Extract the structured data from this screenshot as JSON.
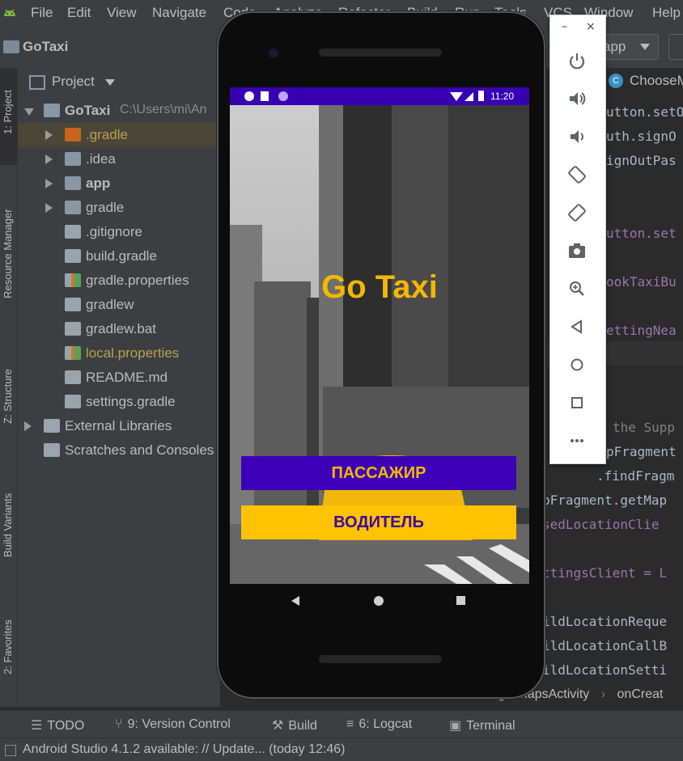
{
  "menubar": {
    "items": [
      "File",
      "Edit",
      "View",
      "Navigate",
      "Code",
      "Analyze",
      "Refactor",
      "Build",
      "Run",
      "Tools",
      "VCS",
      "Window",
      "Help"
    ]
  },
  "toolbar": {
    "project_name": "GoTaxi",
    "run_config": "app"
  },
  "left_tabs": [
    "1: Project",
    "Resource Manager",
    "Z: Structure",
    "Build Variants",
    "2: Favorites"
  ],
  "project_panel": {
    "header": "Project",
    "tree": [
      {
        "label": "GoTaxi",
        "path": "C:\\Users\\mi\\An",
        "icon": "module-folder-icon",
        "color": "#bbbbbb",
        "bold": true
      },
      {
        "label": ".gradle",
        "icon": "folder-orange-icon",
        "color": "#b6a24c"
      },
      {
        "label": ".idea",
        "icon": "folder-icon",
        "color": "#bbbbbb"
      },
      {
        "label": "app",
        "icon": "app-module-icon",
        "color": "#bbbbbb",
        "bold": true
      },
      {
        "label": "gradle",
        "icon": "folder-icon",
        "color": "#bbbbbb"
      },
      {
        "label": ".gitignore",
        "icon": "file-icon",
        "color": "#bbbbbb"
      },
      {
        "label": "build.gradle",
        "icon": "gradle-elephant-icon",
        "color": "#bbbbbb"
      },
      {
        "label": "gradle.properties",
        "icon": "properties-file-icon",
        "color": "#bbbbbb"
      },
      {
        "label": "gradlew",
        "icon": "shell-script-icon",
        "color": "#bbbbbb"
      },
      {
        "label": "gradlew.bat",
        "icon": "file-icon",
        "color": "#bbbbbb"
      },
      {
        "label": "local.properties",
        "icon": "properties-file-icon",
        "color": "#b6a24c"
      },
      {
        "label": "README.md",
        "icon": "markdown-file-icon",
        "color": "#bbbbbb"
      },
      {
        "label": "settings.gradle",
        "icon": "gradle-elephant-icon",
        "color": "#bbbbbb"
      },
      {
        "label": "External Libraries",
        "icon": "libraries-icon",
        "color": "#bbbbbb"
      },
      {
        "label": "Scratches and Consoles",
        "icon": "scratches-icon",
        "color": "#bbbbbb"
      }
    ]
  },
  "editor": {
    "tab": "ChooseM",
    "lines": [
      "utton.setO",
      "uth.signO",
      "ignOutPas",
      "utton.set",
      "ookTaxiBu",
      "ettingNea",
      "the Supp",
      "pFragment",
      ".findFragm",
      "pFragment.getMap",
      "sedLocationClie",
      "ttingsClient = L",
      "ildLocationReque",
      "ildLocationCallB",
      "ildLocationSetti"
    ],
    "breadcrumb": [
      "PassengerMapsActivity",
      "onCreat"
    ]
  },
  "phone": {
    "status_time": "11:20",
    "app_title": "Go Taxi",
    "passenger_button": "ПАССАЖИР",
    "driver_button": "ВОДИТЕЛЬ",
    "colors": {
      "primary": "#3700b3",
      "passenger_bg": "#3d00b8",
      "passenger_text": "#f5b800",
      "driver_bg": "#ffc300",
      "driver_text": "#3d0aa0"
    }
  },
  "emulator_controls": [
    "power-icon",
    "volume-up-icon",
    "volume-down-icon",
    "rotate-left-icon",
    "rotate-right-icon",
    "camera-icon",
    "zoom-icon",
    "back-icon",
    "home-icon",
    "overview-icon",
    "more-icon"
  ],
  "tool_tabs": [
    "TODO",
    "9: Version Control",
    "Build",
    "6: Logcat",
    "Terminal"
  ],
  "status": {
    "message": "Android Studio 4.1.2 available: // Update... (today 12:46)"
  }
}
